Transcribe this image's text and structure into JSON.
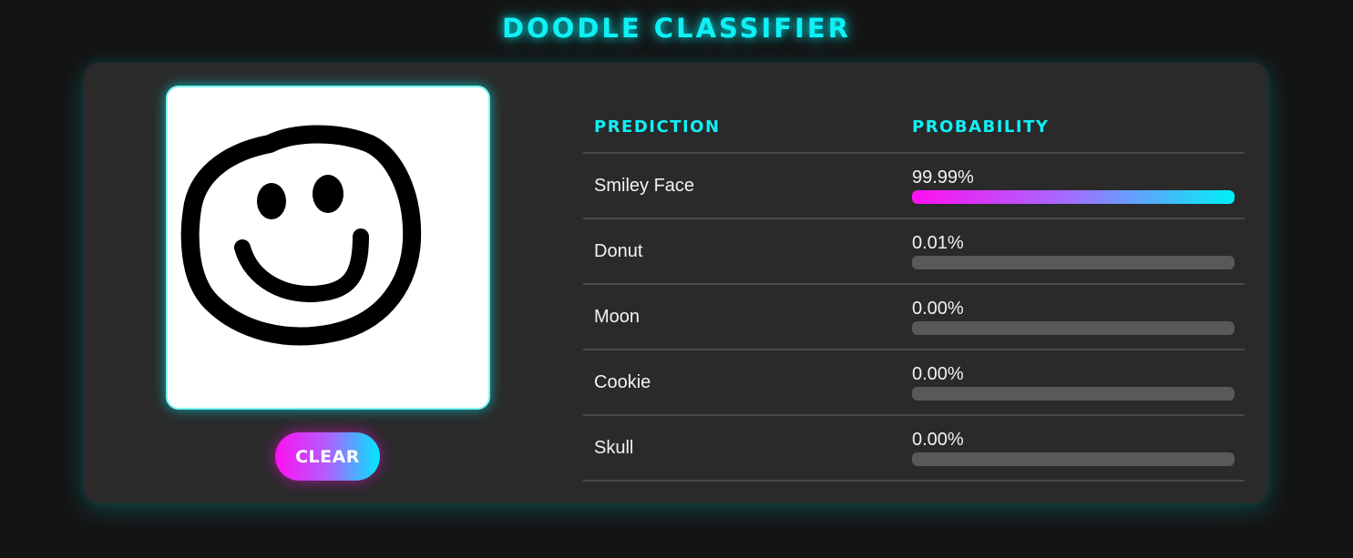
{
  "app": {
    "title": "DOODLE CLASSIFIER"
  },
  "canvas": {
    "drawing_icon": "smiley-face-doodle"
  },
  "controls": {
    "clear_label": "CLEAR"
  },
  "results": {
    "headers": {
      "prediction": "PREDICTION",
      "probability": "PROBABILITY"
    },
    "rows": [
      {
        "label": "Smiley Face",
        "percent_text": "99.99%",
        "probability": 0.9999
      },
      {
        "label": "Donut",
        "percent_text": "0.01%",
        "probability": 0.0001
      },
      {
        "label": "Moon",
        "percent_text": "0.00%",
        "probability": 0.0
      },
      {
        "label": "Cookie",
        "percent_text": "0.00%",
        "probability": 0.0
      },
      {
        "label": "Skull",
        "percent_text": "0.00%",
        "probability": 0.0
      }
    ]
  },
  "colors": {
    "accent_cyan": "#0ff0f5",
    "accent_magenta": "#ff0ff0",
    "panel_bg": "#2a2a2a",
    "page_bg": "#141414",
    "bar_track": "#595959"
  }
}
